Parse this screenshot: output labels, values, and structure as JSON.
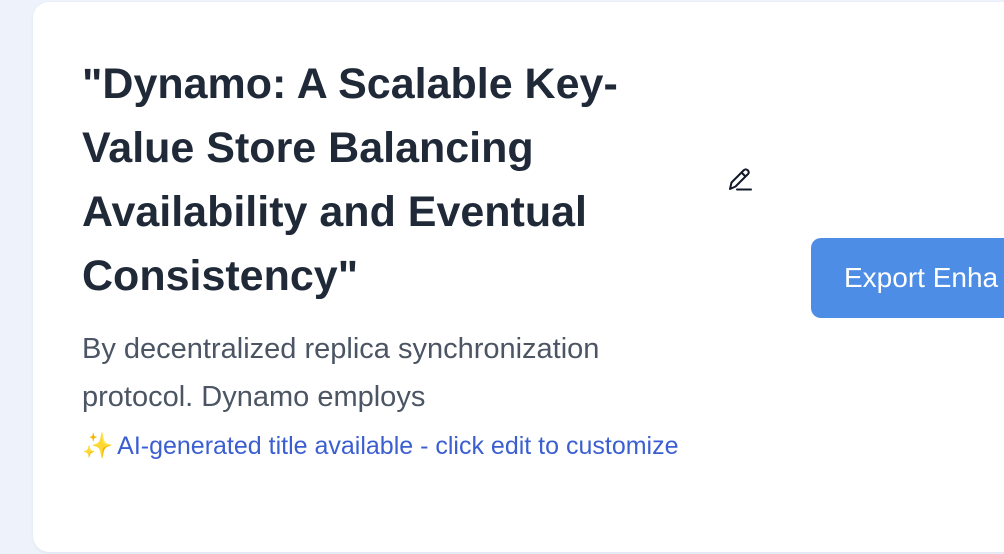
{
  "paper": {
    "title": "\"Dynamo: A Scalable Key-Value Store Balancing Availability and Eventual Consistency\"",
    "subtitle": "By decentralized replica synchronization protocol. Dynamo employs",
    "ai_note": {
      "icon": "sparkles-icon",
      "icon_glyph": "✨",
      "text": "AI-generated title available - click edit to customize"
    },
    "edit_icon": "pencil-icon"
  },
  "actions": {
    "export_label": "Export Enha"
  },
  "colors": {
    "background": "#eef3fb",
    "card": "#ffffff",
    "title": "#1f2937",
    "subtitle": "#4b5563",
    "ai_note": "#3b5fd1",
    "export_button": "#4d8de6"
  }
}
